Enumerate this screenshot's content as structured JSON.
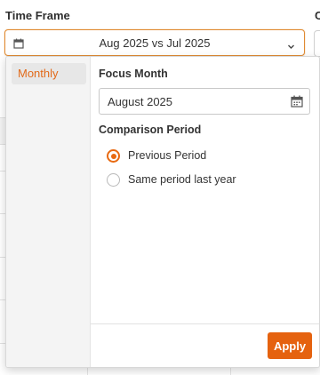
{
  "time_frame": {
    "label": "Time Frame",
    "second_label_fragment": "C",
    "selected_value": "Aug 2025 vs Jul 2025"
  },
  "popover": {
    "side_menu": {
      "items": [
        {
          "label": "Monthly",
          "active": true
        }
      ]
    },
    "focus_month": {
      "title": "Focus Month",
      "value": "August 2025"
    },
    "comparison_period": {
      "title": "Comparison Period",
      "options": [
        {
          "label": "Previous Period",
          "checked": true
        },
        {
          "label": "Same period last year",
          "checked": false
        }
      ]
    },
    "apply_label": "Apply"
  },
  "colors": {
    "accent": "#e5620f",
    "focus_border": "#e08a32"
  },
  "icons": {
    "time_frame_icon": "calendar-icon",
    "dropdown_icon": "chevron-down-icon",
    "month_picker_icon": "calendar-icon"
  }
}
